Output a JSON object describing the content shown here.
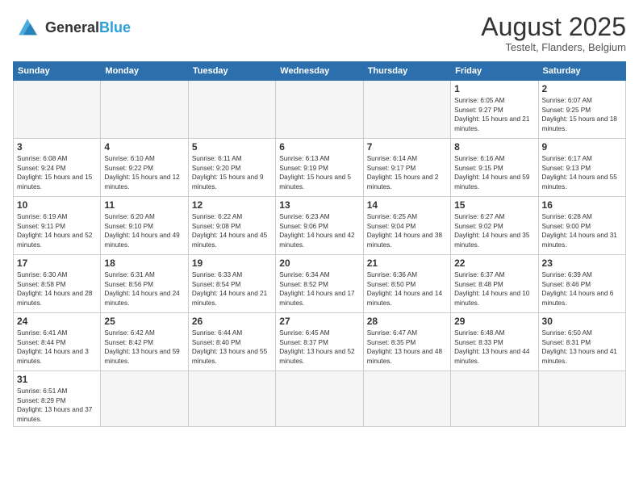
{
  "header": {
    "logo_general": "General",
    "logo_blue": "Blue",
    "month_year": "August 2025",
    "location": "Testelt, Flanders, Belgium"
  },
  "days_of_week": [
    "Sunday",
    "Monday",
    "Tuesday",
    "Wednesday",
    "Thursday",
    "Friday",
    "Saturday"
  ],
  "weeks": [
    [
      {
        "day": "",
        "info": ""
      },
      {
        "day": "",
        "info": ""
      },
      {
        "day": "",
        "info": ""
      },
      {
        "day": "",
        "info": ""
      },
      {
        "day": "",
        "info": ""
      },
      {
        "day": "1",
        "info": "Sunrise: 6:05 AM\nSunset: 9:27 PM\nDaylight: 15 hours and 21 minutes."
      },
      {
        "day": "2",
        "info": "Sunrise: 6:07 AM\nSunset: 9:25 PM\nDaylight: 15 hours and 18 minutes."
      }
    ],
    [
      {
        "day": "3",
        "info": "Sunrise: 6:08 AM\nSunset: 9:24 PM\nDaylight: 15 hours and 15 minutes."
      },
      {
        "day": "4",
        "info": "Sunrise: 6:10 AM\nSunset: 9:22 PM\nDaylight: 15 hours and 12 minutes."
      },
      {
        "day": "5",
        "info": "Sunrise: 6:11 AM\nSunset: 9:20 PM\nDaylight: 15 hours and 9 minutes."
      },
      {
        "day": "6",
        "info": "Sunrise: 6:13 AM\nSunset: 9:19 PM\nDaylight: 15 hours and 5 minutes."
      },
      {
        "day": "7",
        "info": "Sunrise: 6:14 AM\nSunset: 9:17 PM\nDaylight: 15 hours and 2 minutes."
      },
      {
        "day": "8",
        "info": "Sunrise: 6:16 AM\nSunset: 9:15 PM\nDaylight: 14 hours and 59 minutes."
      },
      {
        "day": "9",
        "info": "Sunrise: 6:17 AM\nSunset: 9:13 PM\nDaylight: 14 hours and 55 minutes."
      }
    ],
    [
      {
        "day": "10",
        "info": "Sunrise: 6:19 AM\nSunset: 9:11 PM\nDaylight: 14 hours and 52 minutes."
      },
      {
        "day": "11",
        "info": "Sunrise: 6:20 AM\nSunset: 9:10 PM\nDaylight: 14 hours and 49 minutes."
      },
      {
        "day": "12",
        "info": "Sunrise: 6:22 AM\nSunset: 9:08 PM\nDaylight: 14 hours and 45 minutes."
      },
      {
        "day": "13",
        "info": "Sunrise: 6:23 AM\nSunset: 9:06 PM\nDaylight: 14 hours and 42 minutes."
      },
      {
        "day": "14",
        "info": "Sunrise: 6:25 AM\nSunset: 9:04 PM\nDaylight: 14 hours and 38 minutes."
      },
      {
        "day": "15",
        "info": "Sunrise: 6:27 AM\nSunset: 9:02 PM\nDaylight: 14 hours and 35 minutes."
      },
      {
        "day": "16",
        "info": "Sunrise: 6:28 AM\nSunset: 9:00 PM\nDaylight: 14 hours and 31 minutes."
      }
    ],
    [
      {
        "day": "17",
        "info": "Sunrise: 6:30 AM\nSunset: 8:58 PM\nDaylight: 14 hours and 28 minutes."
      },
      {
        "day": "18",
        "info": "Sunrise: 6:31 AM\nSunset: 8:56 PM\nDaylight: 14 hours and 24 minutes."
      },
      {
        "day": "19",
        "info": "Sunrise: 6:33 AM\nSunset: 8:54 PM\nDaylight: 14 hours and 21 minutes."
      },
      {
        "day": "20",
        "info": "Sunrise: 6:34 AM\nSunset: 8:52 PM\nDaylight: 14 hours and 17 minutes."
      },
      {
        "day": "21",
        "info": "Sunrise: 6:36 AM\nSunset: 8:50 PM\nDaylight: 14 hours and 14 minutes."
      },
      {
        "day": "22",
        "info": "Sunrise: 6:37 AM\nSunset: 8:48 PM\nDaylight: 14 hours and 10 minutes."
      },
      {
        "day": "23",
        "info": "Sunrise: 6:39 AM\nSunset: 8:46 PM\nDaylight: 14 hours and 6 minutes."
      }
    ],
    [
      {
        "day": "24",
        "info": "Sunrise: 6:41 AM\nSunset: 8:44 PM\nDaylight: 14 hours and 3 minutes."
      },
      {
        "day": "25",
        "info": "Sunrise: 6:42 AM\nSunset: 8:42 PM\nDaylight: 13 hours and 59 minutes."
      },
      {
        "day": "26",
        "info": "Sunrise: 6:44 AM\nSunset: 8:40 PM\nDaylight: 13 hours and 55 minutes."
      },
      {
        "day": "27",
        "info": "Sunrise: 6:45 AM\nSunset: 8:37 PM\nDaylight: 13 hours and 52 minutes."
      },
      {
        "day": "28",
        "info": "Sunrise: 6:47 AM\nSunset: 8:35 PM\nDaylight: 13 hours and 48 minutes."
      },
      {
        "day": "29",
        "info": "Sunrise: 6:48 AM\nSunset: 8:33 PM\nDaylight: 13 hours and 44 minutes."
      },
      {
        "day": "30",
        "info": "Sunrise: 6:50 AM\nSunset: 8:31 PM\nDaylight: 13 hours and 41 minutes."
      }
    ],
    [
      {
        "day": "31",
        "info": "Sunrise: 6:51 AM\nSunset: 8:29 PM\nDaylight: 13 hours and 37 minutes."
      },
      {
        "day": "",
        "info": ""
      },
      {
        "day": "",
        "info": ""
      },
      {
        "day": "",
        "info": ""
      },
      {
        "day": "",
        "info": ""
      },
      {
        "day": "",
        "info": ""
      },
      {
        "day": "",
        "info": ""
      }
    ]
  ]
}
